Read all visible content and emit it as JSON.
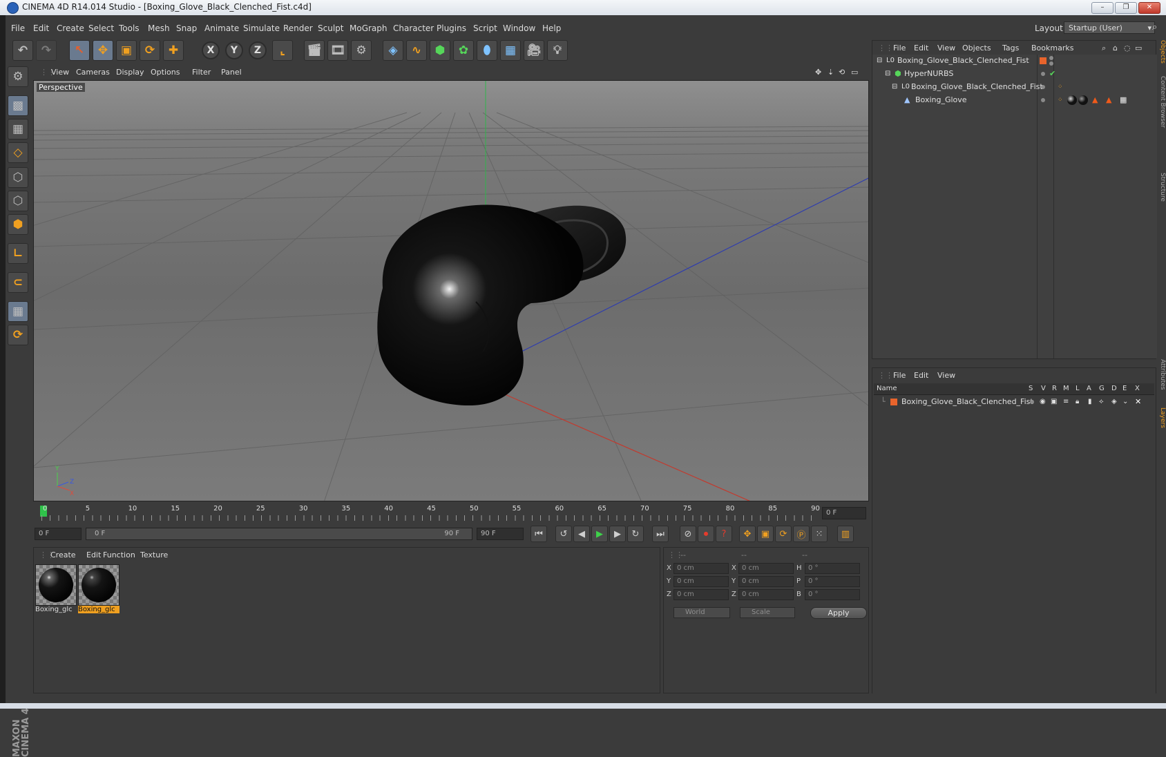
{
  "window": {
    "title": "CINEMA 4D R14.014 Studio - [Boxing_Glove_Black_Clenched_Fist.c4d]",
    "min": "–",
    "max": "❐",
    "close": "✕"
  },
  "menubar": {
    "items": [
      "File",
      "Edit",
      "Create",
      "Select",
      "Tools",
      "Mesh",
      "Snap",
      "Animate",
      "Simulate",
      "Render",
      "Sculpt",
      "MoGraph",
      "Character",
      "Plugins",
      "Script",
      "Window",
      "Help"
    ],
    "layout_label": "Layout:",
    "layout_value": "Startup (User)"
  },
  "viewport": {
    "menu": [
      "View",
      "Cameras",
      "Display",
      "Options",
      "Filter",
      "Panel"
    ],
    "label": "Perspective"
  },
  "timeline": {
    "ticks": [
      "0",
      "5",
      "10",
      "15",
      "20",
      "25",
      "30",
      "35",
      "40",
      "45",
      "50",
      "55",
      "60",
      "65",
      "70",
      "75",
      "80",
      "85",
      "90"
    ],
    "current_frame": "0 F",
    "start_field": "0 F",
    "range_start": "0 F",
    "range_end": "90 F",
    "end_field": "90 F"
  },
  "material_manager": {
    "menu": [
      "Create",
      "Edit",
      "Function",
      "Texture"
    ],
    "materials": [
      {
        "label": "Boxing_glc",
        "selected": false
      },
      {
        "label": "Boxing_glc",
        "selected": true
      }
    ]
  },
  "coordinates": {
    "headers": [
      "--",
      "--",
      "--"
    ],
    "rows": [
      {
        "a": "X",
        "av": "0 cm",
        "b": "X",
        "bv": "0 cm",
        "c": "H",
        "cv": "0 °"
      },
      {
        "a": "Y",
        "av": "0 cm",
        "b": "Y",
        "bv": "0 cm",
        "c": "P",
        "cv": "0 °"
      },
      {
        "a": "Z",
        "av": "0 cm",
        "b": "Z",
        "bv": "0 cm",
        "c": "B",
        "cv": "0 °"
      }
    ],
    "world": "World",
    "scale": "Scale",
    "apply": "Apply"
  },
  "object_manager": {
    "menu": [
      "File",
      "Edit",
      "View",
      "Objects",
      "Tags",
      "Bookmarks"
    ],
    "objects": [
      {
        "name": "Boxing_Glove_Black_Clenched_Fist"
      },
      {
        "name": "HyperNURBS"
      },
      {
        "name": "Boxing_Glove_Black_Clenched_Fist"
      },
      {
        "name": "Boxing_Glove"
      }
    ]
  },
  "layer_manager": {
    "menu": [
      "File",
      "Edit",
      "View"
    ],
    "columns": [
      "Name",
      "S",
      "V",
      "R",
      "M",
      "L",
      "A",
      "G",
      "D",
      "E",
      "X"
    ],
    "layers": [
      {
        "name": "Boxing_Glove_Black_Clenched_Fist"
      }
    ]
  },
  "right_tabs": [
    "Objects",
    "Content Browser",
    "Structure",
    "Attributes",
    "Layers"
  ],
  "brand": "MAXON CINEMA 4D",
  "colors": {
    "accent": "#f0a020",
    "panel": "#3b3b3b",
    "selected_material": "#f0a020",
    "layer_color": "#e8642c"
  }
}
